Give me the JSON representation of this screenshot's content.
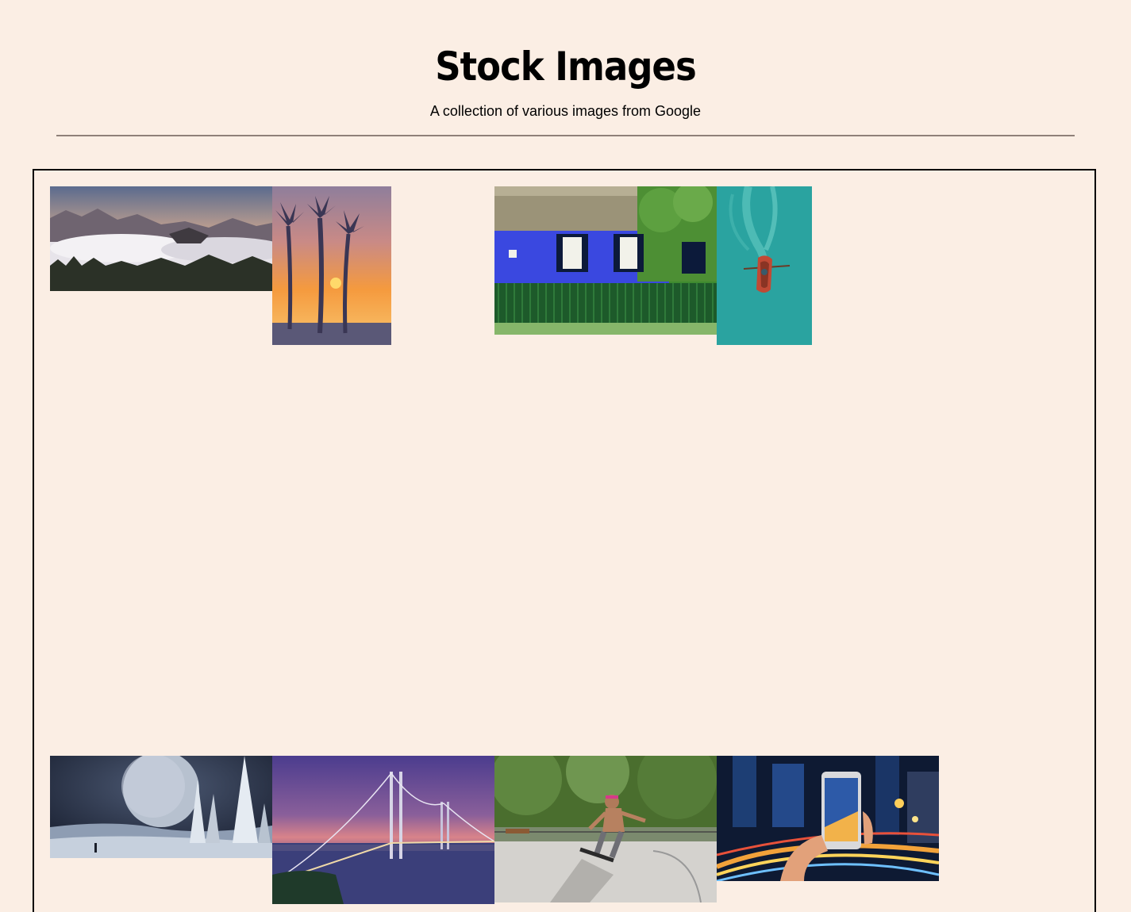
{
  "header": {
    "title": "Stock Images",
    "subtitle": "A collection of various images from Google"
  },
  "gallery": {
    "images": [
      {
        "subject": "misty mountain valley at sunrise"
      },
      {
        "subject": "palm tree silhouettes at sunset"
      },
      {
        "subject": "blue cottage with thatched roof and green fence"
      },
      {
        "subject": "red rowboat on turquoise water"
      },
      {
        "subject": "fantasy moon landscape with spires"
      },
      {
        "subject": "suspension bridge at dusk"
      },
      {
        "subject": "skateboarder in skate park"
      },
      {
        "subject": "hand holding smartphone over city light trails"
      }
    ]
  }
}
